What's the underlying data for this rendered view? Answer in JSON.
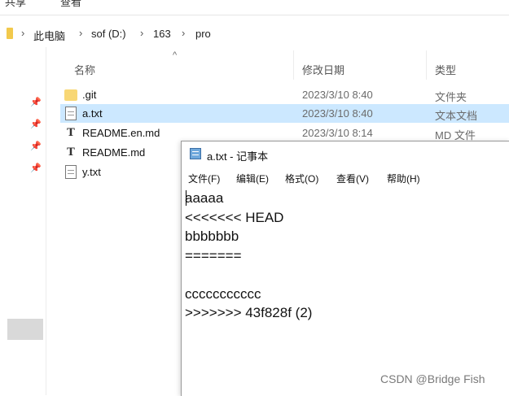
{
  "ribbon": {
    "tabs": [
      "共享",
      "查看"
    ]
  },
  "address": {
    "crumbs": [
      "此电脑",
      "sof (D:)",
      "163",
      "pro"
    ],
    "sep": "›"
  },
  "columns": {
    "name": "名称",
    "date": "修改日期",
    "type": "类型",
    "sort_indicator": "^"
  },
  "files": [
    {
      "name": ".git",
      "date": "2023/3/10 8:40",
      "type": "文件夹",
      "icon": "folder-icon"
    },
    {
      "name": "a.txt",
      "date": "2023/3/10 8:40",
      "type": "文本文档",
      "icon": "text-file-icon"
    },
    {
      "name": "README.en.md",
      "date": "2023/3/10 8:14",
      "type": "MD 文件",
      "icon": "markdown-file-icon"
    },
    {
      "name": "README.md",
      "date": "",
      "type": "",
      "icon": "markdown-file-icon"
    },
    {
      "name": "y.txt",
      "date": "",
      "type": "",
      "icon": "text-file-icon"
    }
  ],
  "notepad": {
    "title": "a.txt - 记事本",
    "menu": [
      "文件(F)",
      "编辑(E)",
      "格式(O)",
      "查看(V)",
      "帮助(H)"
    ],
    "lines": [
      "aaaaa",
      "<<<<<<< HEAD",
      "bbbbbbb",
      "=======",
      "",
      "ccccccccccc",
      ">>>>>>> 43f828f (2)"
    ]
  },
  "watermark": "CSDN @Bridge Fish",
  "colors": {
    "selected_row": "#cce8ff",
    "hover_row": "#e5f3ff",
    "folder": "#f8d775"
  }
}
